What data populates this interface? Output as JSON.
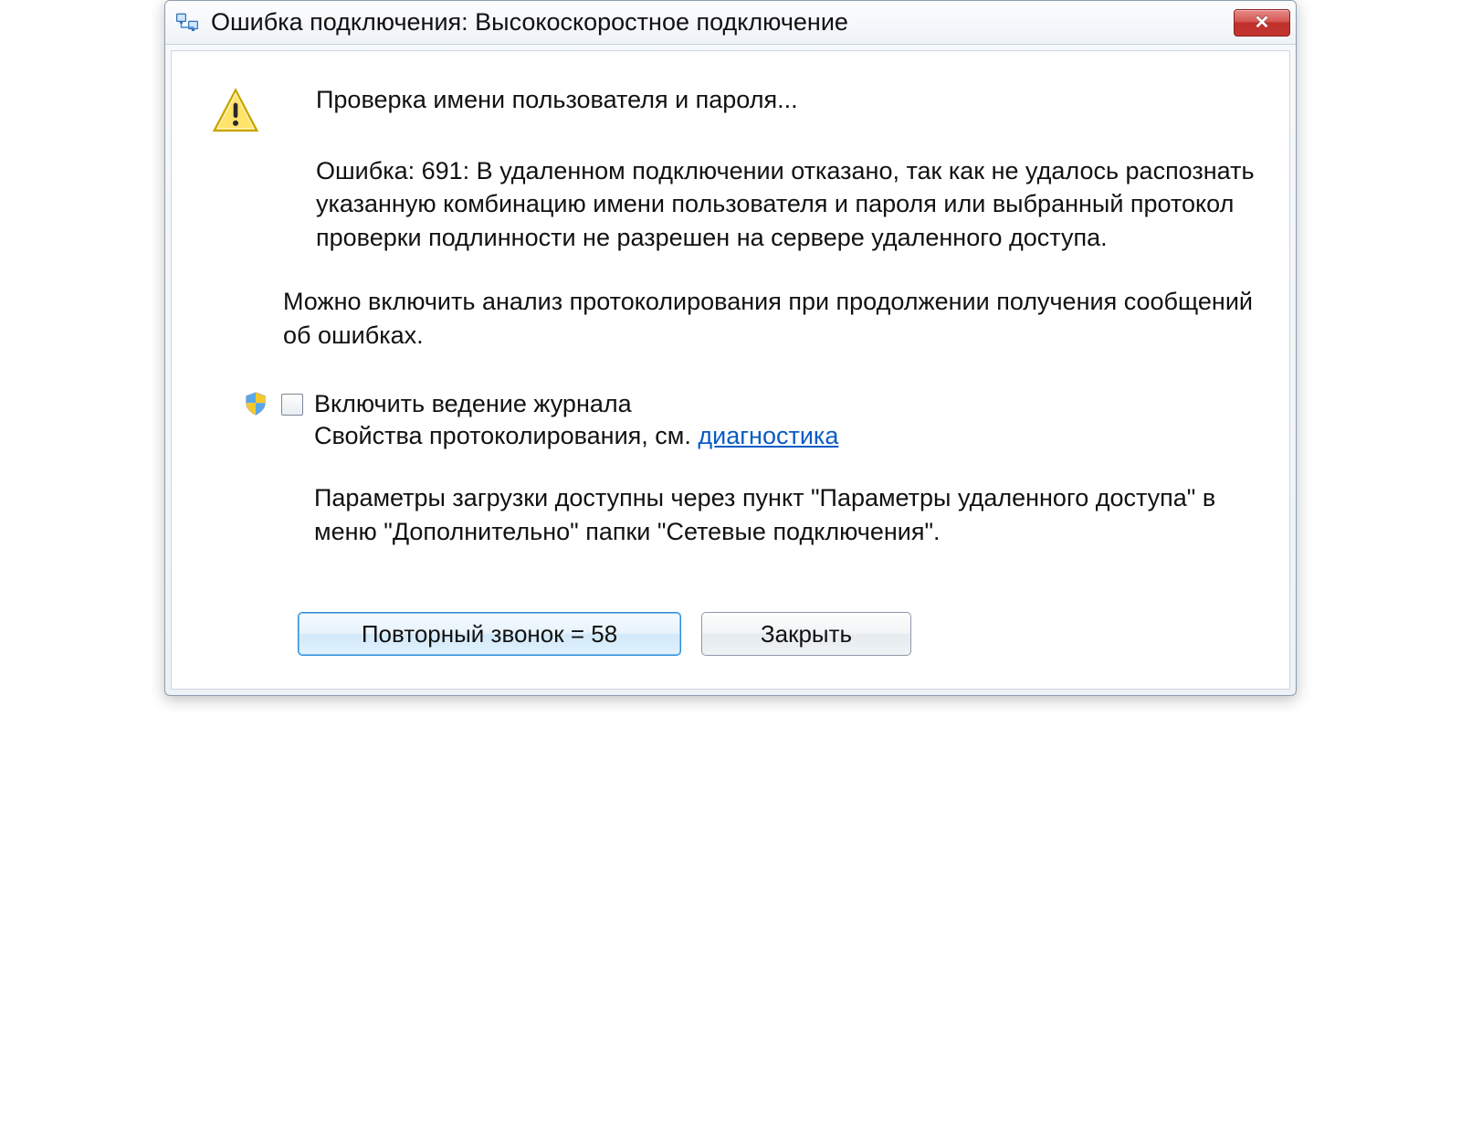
{
  "titlebar": {
    "title": "Ошибка подключения: Высокоскоростное подключение"
  },
  "message": {
    "status": "Проверка имени пользователя и пароля...",
    "error": "Ошибка: 691: В удаленном подключении отказано, так как не удалось распознать указанную комбинацию имени пользователя и пароля или выбранный протокол проверки подлинности не разрешен на сервере удаленного доступа.",
    "note": "Можно включить анализ протоколирования при продолжении получения сообщений об ошибках."
  },
  "logging": {
    "checkbox_label": "Включить ведение журнала",
    "sub_prefix": "Свойства протоколирования, см. ",
    "link": "диагностика"
  },
  "params": "Параметры загрузки доступны через пункт \"Параметры удаленного доступа\" в меню \"Дополнительно\" папки \"Сетевые подключения\".",
  "buttons": {
    "redial": "Повторный звонок = 58",
    "close": "Закрыть"
  }
}
